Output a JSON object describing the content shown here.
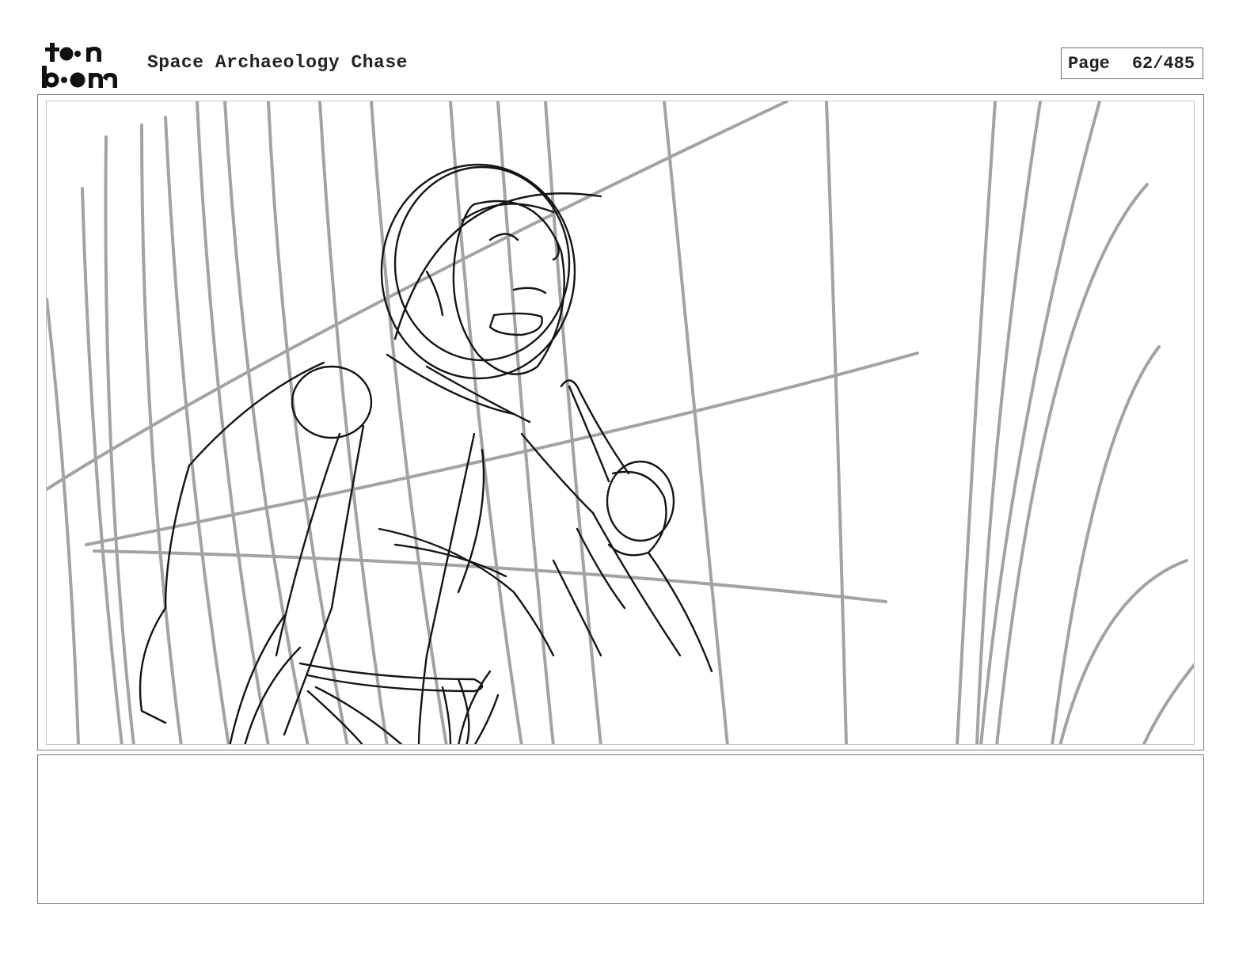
{
  "header": {
    "logo_line1": "toon",
    "logo_line2": "boom",
    "project_title": "Space Archaeology Chase",
    "page_label": "Page",
    "page_number": "62/485"
  },
  "panel": {
    "caption_text": ""
  },
  "colors": {
    "sketch_dark": "#111111",
    "sketch_gray": "#9f9f9f",
    "frame_border": "#7a7a7a"
  }
}
